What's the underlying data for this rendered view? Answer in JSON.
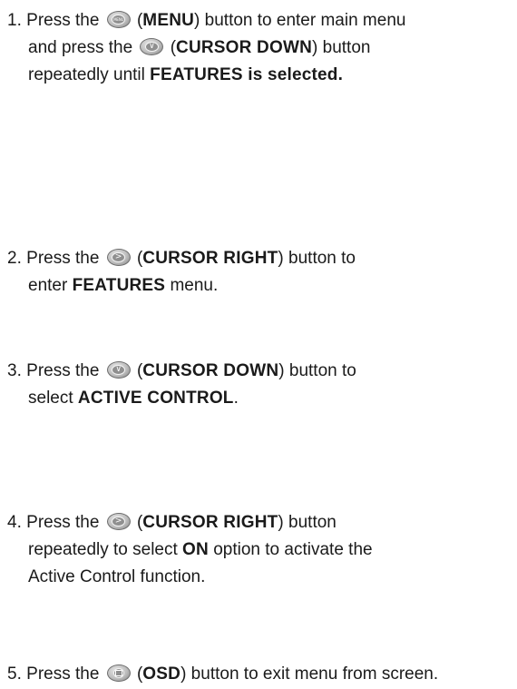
{
  "steps": [
    {
      "number": "1.",
      "lines": [
        [
          "Press the ",
          {
            "icon": "menu-button-icon",
            "glyph": "MENU"
          },
          " (",
          {
            "b": "MENU"
          },
          ") button to enter main menu"
        ],
        [
          "and press the ",
          {
            "icon": "cursor-down-button-icon",
            "glyph": "∨"
          },
          " (",
          {
            "b": "CURSOR DOWN"
          },
          ") button"
        ],
        [
          "repeatedly until ",
          {
            "b": "FEATURES is selected."
          }
        ]
      ]
    },
    {
      "number": "2.",
      "lines": [
        [
          "Press the ",
          {
            "icon": "cursor-right-button-icon",
            "glyph": ">"
          },
          " (",
          {
            "b": "CURSOR RIGHT"
          },
          ") button to"
        ],
        [
          "enter ",
          {
            "b": "FEATURES"
          },
          " menu."
        ]
      ]
    },
    {
      "number": "3.",
      "lines": [
        [
          "Press the ",
          {
            "icon": "cursor-down-button-icon",
            "glyph": "∨"
          },
          " (",
          {
            "b": "CURSOR DOWN"
          },
          ") button to"
        ],
        [
          "select ",
          {
            "b": "ACTIVE CONTROL"
          },
          "."
        ]
      ]
    },
    {
      "number": "4.",
      "lines": [
        [
          "Press the ",
          {
            "icon": "cursor-right-button-icon",
            "glyph": ">"
          },
          " (",
          {
            "b": "CURSOR RIGHT"
          },
          ") button"
        ],
        [
          "repeatedly to select ",
          {
            "b": "ON"
          },
          " option to activate the"
        ],
        [
          "Active Control function."
        ]
      ]
    },
    {
      "number": "5.",
      "lines": [
        [
          "Press the ",
          {
            "icon": "osd-button-icon",
            "glyph": "osd"
          },
          " (",
          {
            "b": "OSD"
          },
          ") button to exit menu from screen."
        ]
      ]
    }
  ]
}
